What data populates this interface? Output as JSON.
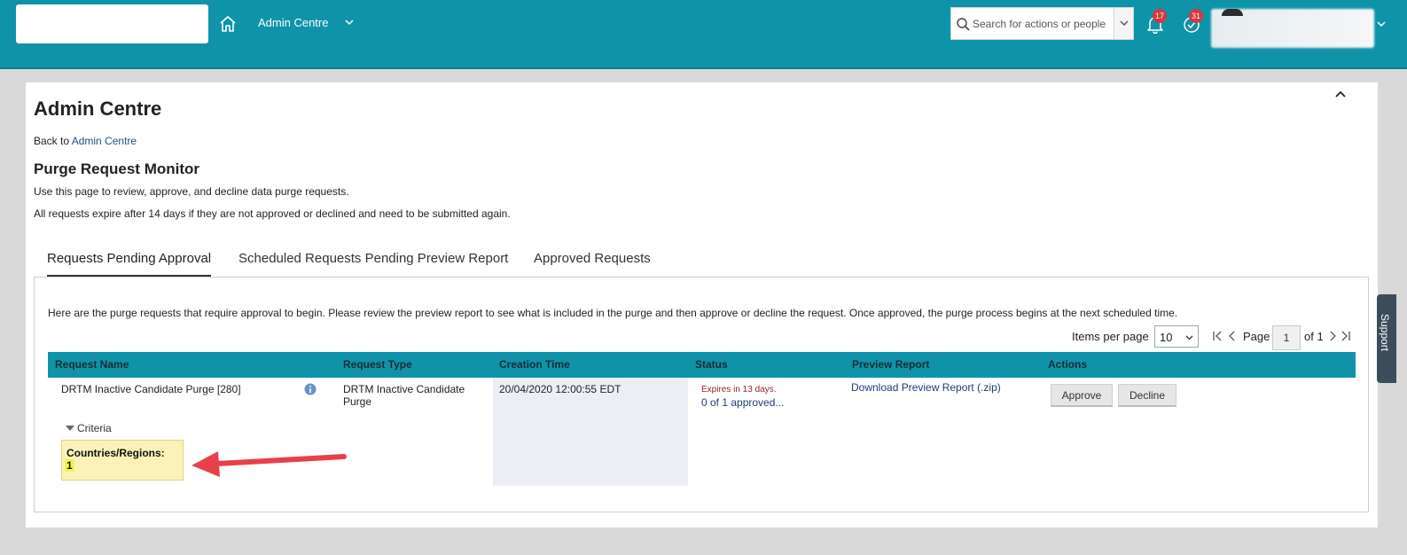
{
  "header": {
    "module_title": "Admin Centre",
    "search_placeholder": "Search for actions or people",
    "notifications_count": "17",
    "todo_count": "31"
  },
  "page": {
    "title": "Admin Centre",
    "back_prefix": "Back to ",
    "back_link": "Admin Centre",
    "section_title": "Purge Request Monitor",
    "desc1": "Use this page to review, approve, and decline data purge requests.",
    "desc2": "All requests expire after 14 days if they are not approved or declined and need to be submitted again."
  },
  "tabs": [
    {
      "label": "Requests Pending Approval",
      "active": true
    },
    {
      "label": "Scheduled Requests Pending Preview Report",
      "active": false
    },
    {
      "label": "Approved Requests",
      "active": false
    }
  ],
  "panel": {
    "description": "Here are the purge requests that require approval to begin. Please review the preview report to see what is included in the purge and then approve or decline the request. Once approved, the purge process begins at the next scheduled time.",
    "items_per_page_label": "Items per page",
    "items_per_page": "10",
    "page_label": "Page",
    "page_value": "1",
    "of_label": "of 1"
  },
  "table": {
    "headers": [
      "Request Name",
      "Request Type",
      "Creation Time",
      "Status",
      "Preview Report",
      "Actions"
    ],
    "row": {
      "name": "DRTM Inactive Candidate Purge [280]",
      "type_line1": "DRTM Inactive Candidate",
      "type_line2": "Purge",
      "creation_time": "20/04/2020 12:00:55 EDT",
      "status_expires": "Expires in 13 days.",
      "status_approved": "0 of 1 approved...",
      "preview_link": "Download Preview Report (.zip)",
      "approve_label": "Approve",
      "decline_label": "Decline",
      "criteria_label": "Criteria",
      "criteria_key": "Countries/Regions:",
      "criteria_value": "1"
    }
  },
  "support_label": "Support",
  "colors": {
    "header_bg": "#0f93a8",
    "badge": "#d9363e",
    "criteria_highlight": "#faf2b8",
    "annotation_arrow": "#e8404a"
  }
}
